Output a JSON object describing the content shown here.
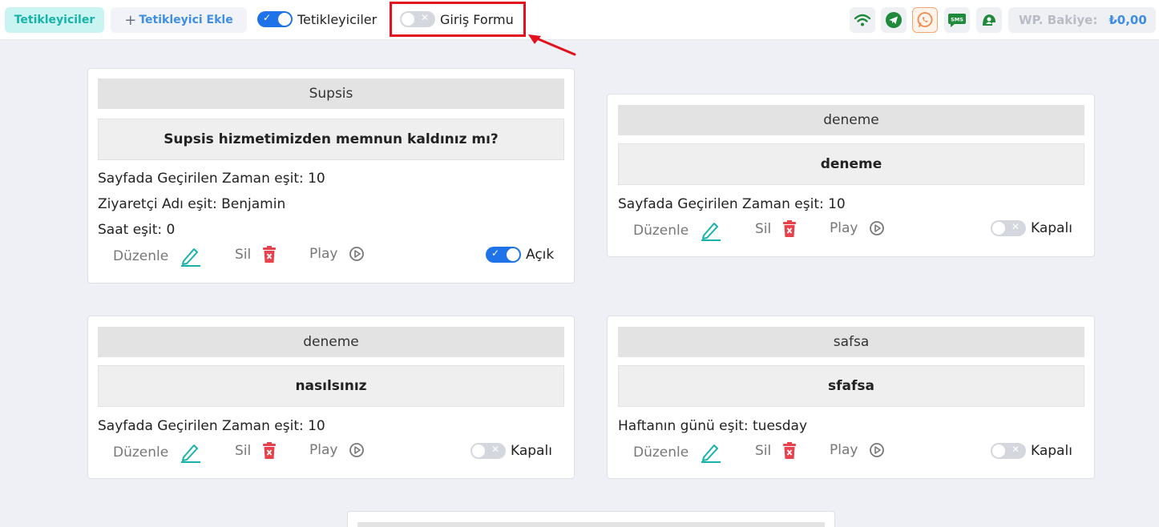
{
  "topbar": {
    "tab_active": "Tetikleyiciler",
    "tab_add": "Tetikleyici Ekle",
    "toggle_triggers_label": "Tetikleyiciler",
    "toggle_login_form_label": "Giriş Formu",
    "balance_label": "WP. Bakiye:",
    "balance_value": "₺0,00",
    "status_icons": [
      "wifi-icon",
      "telegram-icon",
      "whatsapp-icon",
      "sms-icon",
      "contact-icon"
    ]
  },
  "actions": {
    "edit": "Düzenle",
    "delete": "Sil",
    "play": "Play"
  },
  "cards": [
    {
      "title": "Supsis",
      "message": "Supsis hizmetimizden memnun kaldınız mı?",
      "conditions": [
        "Sayfada Geçirilen Zaman eşit: 10",
        "Ziyaretçi Adı eşit: Benjamin",
        "Saat eşit: 0"
      ],
      "status": "Açık",
      "enabled": true
    },
    {
      "title": "deneme",
      "message": "deneme",
      "conditions": [
        "Sayfada Geçirilen Zaman eşit: 10"
      ],
      "status": "Kapalı",
      "enabled": false
    },
    {
      "title": "deneme",
      "message": "nasılsınız",
      "conditions": [
        "Sayfada Geçirilen Zaman eşit: 10"
      ],
      "status": "Kapalı",
      "enabled": false
    },
    {
      "title": "safsa",
      "message": "sfafsa",
      "conditions": [
        "Haftanın günü eşit: tuesday"
      ],
      "status": "Kapalı",
      "enabled": false
    }
  ],
  "colors": {
    "accent_teal": "#17b3a9",
    "accent_blue": "#1f73e8",
    "delete_red": "#e8424e",
    "highlight_red": "#e3101d"
  }
}
